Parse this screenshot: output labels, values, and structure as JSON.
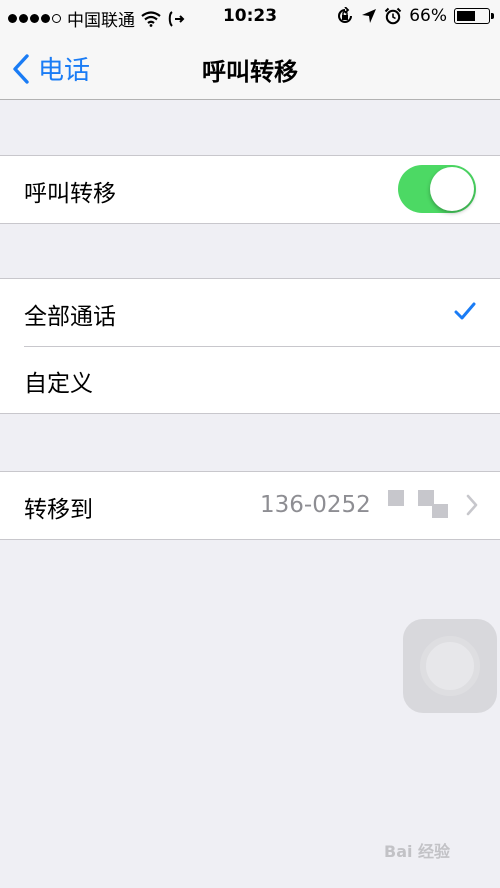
{
  "status_bar": {
    "carrier": "中国联通",
    "time": "10:23",
    "battery": "66%",
    "battery_level": 0.66,
    "signal_dots_filled": 4,
    "signal_dots_total": 5
  },
  "nav": {
    "back_label": "电话",
    "title": "呼叫转移"
  },
  "call_forwarding": {
    "label": "呼叫转移",
    "enabled": true
  },
  "mode_options": [
    {
      "label": "全部通话",
      "selected": true
    },
    {
      "label": "自定义",
      "selected": false
    }
  ],
  "forward_to": {
    "label": "转移到",
    "value": "136-0252"
  },
  "watermark": "Bai 经验",
  "colors": {
    "accent": "#1a7cf5",
    "toggle_on": "#4cd964",
    "background": "#efeff4"
  }
}
